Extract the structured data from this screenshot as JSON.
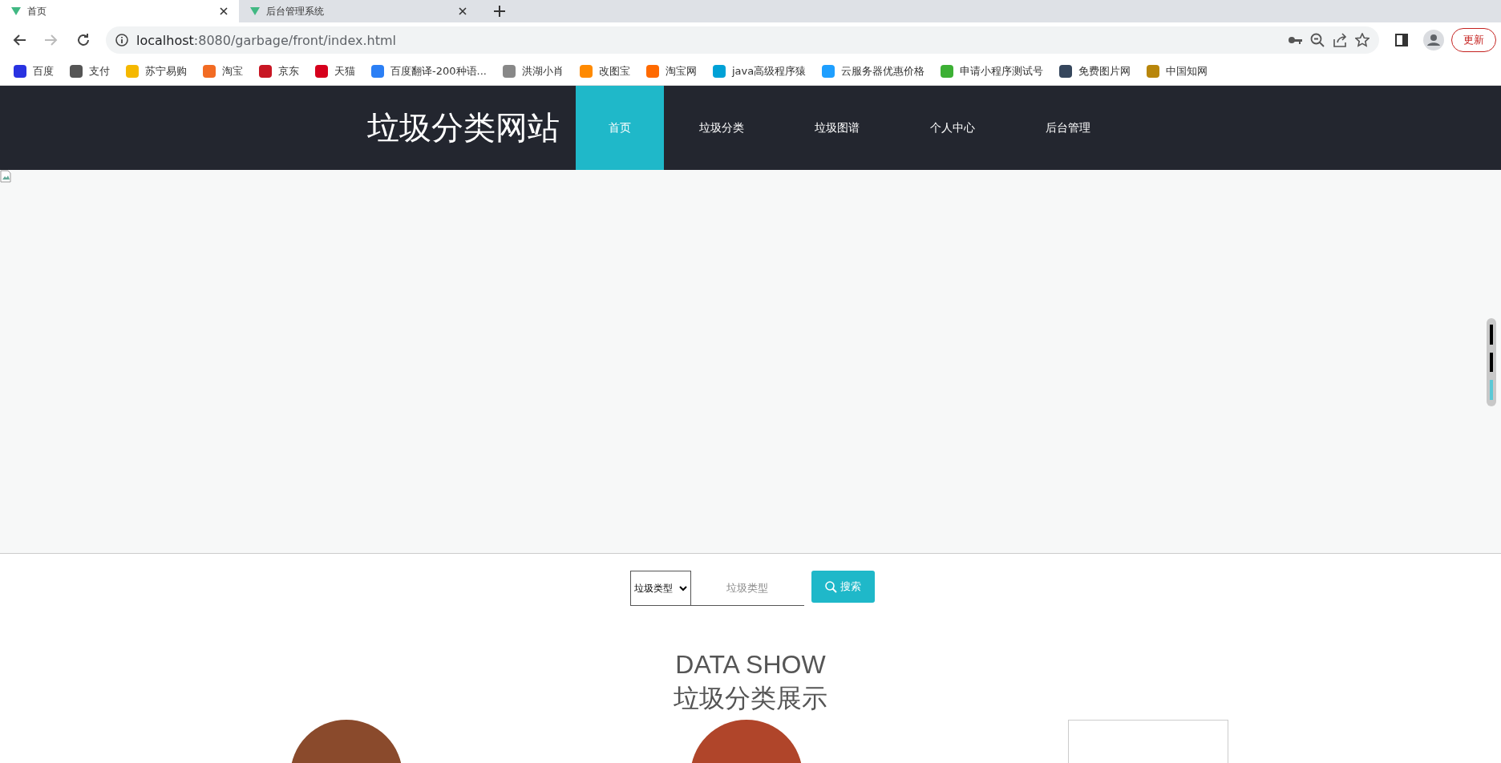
{
  "browser": {
    "tabs": [
      {
        "title": "首页",
        "selected": true
      },
      {
        "title": "后台管理系统",
        "selected": false
      }
    ],
    "address": {
      "host": "localhost",
      "path": ":8080/garbage/front/index.html"
    },
    "update_button": "更新",
    "bookmarks": [
      {
        "label": "百度",
        "color": "#2932e1"
      },
      {
        "label": "支付",
        "color": "#555555"
      },
      {
        "label": "苏宁易购",
        "color": "#f5b800"
      },
      {
        "label": "淘宝",
        "color": "#f26b23"
      },
      {
        "label": "京东",
        "color": "#c81623"
      },
      {
        "label": "天猫",
        "color": "#d6001c"
      },
      {
        "label": "百度翻译-200种语...",
        "color": "#2b7ff5"
      },
      {
        "label": "洪湖小肖",
        "color": "#888888"
      },
      {
        "label": "改图宝",
        "color": "#ff8a00"
      },
      {
        "label": "淘宝网",
        "color": "#ff6a00"
      },
      {
        "label": "java高级程序猿",
        "color": "#00a1d6"
      },
      {
        "label": "云服务器优惠价格",
        "color": "#1e9fff"
      },
      {
        "label": "申请小程序测试号",
        "color": "#3cb034"
      },
      {
        "label": "免费图片网",
        "color": "#35465c"
      },
      {
        "label": "中国知网",
        "color": "#b8860b"
      }
    ]
  },
  "site": {
    "logo": "垃圾分类网站",
    "nav": [
      {
        "label": "首页",
        "selected": true
      },
      {
        "label": "垃圾分类",
        "selected": false
      },
      {
        "label": "垃圾图谱",
        "selected": false
      },
      {
        "label": "个人中心",
        "selected": false
      },
      {
        "label": "后台管理",
        "selected": false
      }
    ],
    "carousel_indicators": [
      {
        "selected": false
      },
      {
        "selected": false
      },
      {
        "selected": true
      }
    ],
    "search": {
      "select_value": "垃圾类型",
      "placeholder": "垃圾类型",
      "button": "搜索"
    },
    "section": {
      "title_en": "DATA SHOW",
      "title_cn": "垃圾分类展示"
    }
  }
}
